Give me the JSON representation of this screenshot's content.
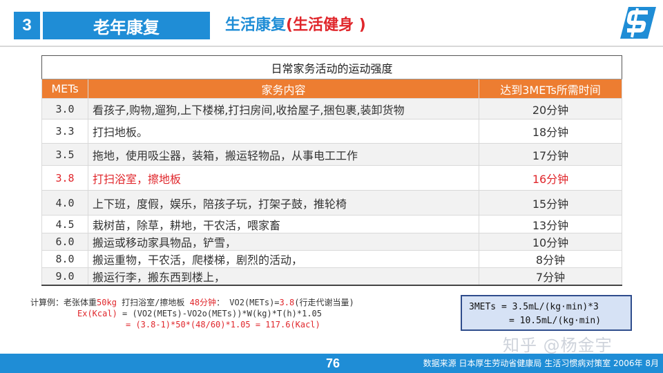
{
  "header": {
    "section_number": "3",
    "section_title": "老年康复",
    "subtitle_main": "生活康复",
    "subtitle_highlight": "(生活健身 )"
  },
  "table": {
    "caption": "日常家务活动的运动强度",
    "headers": [
      "METs",
      "家务内容",
      "达到3METs所需时间"
    ],
    "rows": [
      {
        "mets": "3.0",
        "content": "看孩子,购物,遛狗,上下楼梯,打扫房间,收拾屋子,捆包裹,装卸货物",
        "time": "20分钟"
      },
      {
        "mets": "3.3",
        "content": "打扫地板。",
        "time": "18分钟"
      },
      {
        "mets": "3.5",
        "content": "拖地，使用吸尘器，装箱，搬运轻物品，从事电工工作",
        "time": "17分钟"
      },
      {
        "mets": "3.8",
        "content": "打扫浴室，擦地板",
        "time": "16分钟"
      },
      {
        "mets": "4.0",
        "content": "上下班，度假，娱乐，陪孩子玩，打架子鼓，推轮椅",
        "time": "15分钟"
      },
      {
        "mets": "4.5",
        "content": "栽树苗，除草，耕地，干农活，喂家畜",
        "time": "13分钟"
      },
      {
        "mets": "6.0",
        "content": "搬运或移动家具物品，铲雪，",
        "time": "10分钟"
      },
      {
        "mets": "8.0",
        "content": "搬运重物，干农活，爬楼梯，剧烈的活动，",
        "time": "8分钟"
      },
      {
        "mets": "9.0",
        "content": "搬运行李，搬东西到楼上，",
        "time": "7分钟"
      }
    ]
  },
  "calc": {
    "line1_prefix": "计算例：老张体重",
    "line1_weight": "50kg",
    "line1_mid": " 打扫浴室/擦地板 ",
    "line1_time": "48分钟",
    "line1_colon": "：  VO2(METs)=",
    "line1_value": "3.8",
    "line1_suffix": "(行走代谢当量)",
    "line2_red": "Ex(Kcal)",
    "line2_rest": " = (VO2(METs)-VO2o(METs))*W(kg)*T(h)*1.05",
    "line3": "= (3.8-1)*50*(48/60)*1.05 = 117.6(Kacl)"
  },
  "formula": {
    "line1": "3METs = 3.5mL/(kg·min)*3",
    "line2": "= 10.5mL/(kg·min)"
  },
  "watermark": "知乎 @杨金宇",
  "footer": {
    "page": "76",
    "source": "数据来源 日本厚生劳动省健康局 生活习惯病对策室 2006年 8月"
  },
  "colors": {
    "brand_blue": "#1F8DD6",
    "header_orange": "#ED7D31",
    "highlight_red": "#E0262B"
  }
}
